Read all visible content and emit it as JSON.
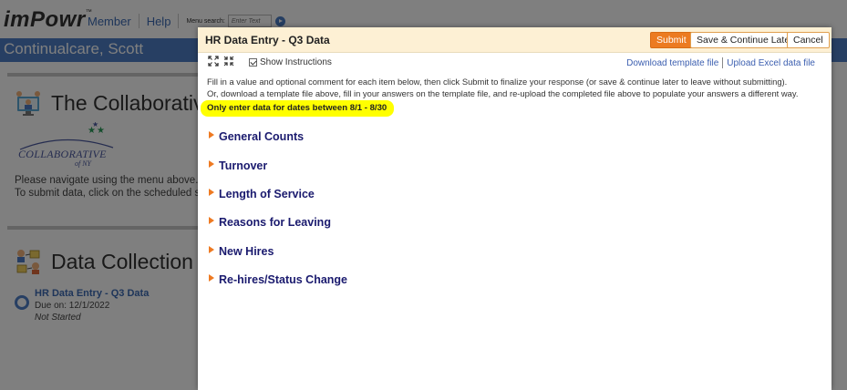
{
  "app": {
    "logo": "imPowr",
    "logo_mark": "™",
    "nav": {
      "member": "Member",
      "help": "Help"
    },
    "menu_search": {
      "label": "Menu search:",
      "placeholder": "Enter Text"
    },
    "user_name": "Continualcare, Scott"
  },
  "panels": {
    "collaborative": {
      "title": "The Collaborative",
      "logo_text": "COLLABORATIVE",
      "logo_subtext": "of NY",
      "line1": "Please navigate using the menu above.",
      "line2": "To submit data, click on the scheduled su"
    },
    "data_collection": {
      "title": "Data Collection",
      "task": {
        "title": "HR Data Entry - Q3 Data",
        "due": "Due on: 12/1/2022",
        "status": "Not Started"
      }
    }
  },
  "modal": {
    "title": "HR Data Entry - Q3 Data",
    "buttons": {
      "submit": "Submit",
      "save_continue": "Save & Continue Later",
      "cancel": "Cancel"
    },
    "show_instructions": "Show Instructions",
    "links": {
      "download_template": "Download template file",
      "upload_excel": "Upload Excel data file"
    },
    "instructions_line1": "Fill in a value and optional comment for each item below, then click Submit to finalize your response (or save & continue later to leave without submitting).",
    "instructions_line2": "Or, download a template file above, fill in your answers on the template file, and re-upload the completed file above to populate your answers a different way.",
    "notice": "Only enter data for dates between 8/1 - 8/30",
    "sections": [
      {
        "label": "General Counts"
      },
      {
        "label": "Turnover"
      },
      {
        "label": "Length of Service"
      },
      {
        "label": "Reasons for Leaving"
      },
      {
        "label": "New Hires"
      },
      {
        "label": "Re-hires/Status Change"
      }
    ]
  },
  "colors": {
    "accent_blue": "#4f7fc7",
    "submit_orange": "#ec7b21",
    "header_cream": "#fdf0d4",
    "highlight_yellow": "#ffff00",
    "section_navy": "#1a1a6e"
  }
}
